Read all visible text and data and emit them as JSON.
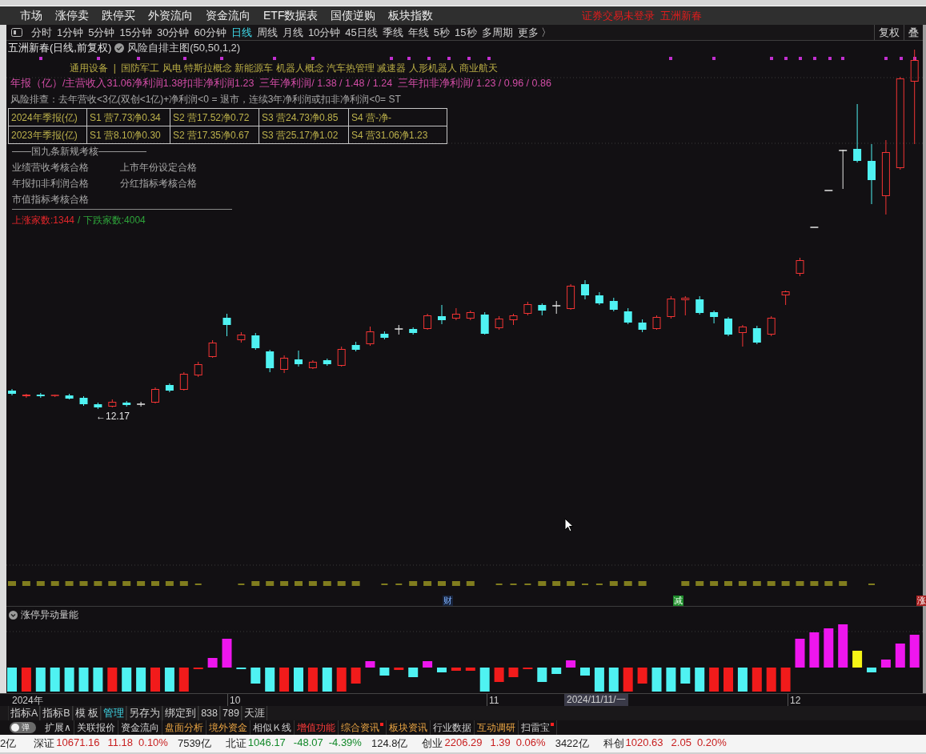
{
  "menu_bar": {
    "items": [
      "市场",
      "涨停卖",
      "跌停买",
      "外资流向",
      "资金流向",
      "ETF数据表",
      "国债逆购",
      "板块指数"
    ],
    "login_status": "证券交易未登录  五洲新春"
  },
  "period_bar": {
    "periods": [
      {
        "label": "分时",
        "selected": false
      },
      {
        "label": "1分钟",
        "selected": false
      },
      {
        "label": "5分钟",
        "selected": false
      },
      {
        "label": "15分钟",
        "selected": false
      },
      {
        "label": "30分钟",
        "selected": false
      },
      {
        "label": "60分钟",
        "selected": false
      },
      {
        "label": "日线",
        "selected": true
      },
      {
        "label": "周线",
        "selected": false
      },
      {
        "label": "月线",
        "selected": false
      },
      {
        "label": "10分钟",
        "selected": false
      },
      {
        "label": "45日线",
        "selected": false
      },
      {
        "label": "季线",
        "selected": false
      },
      {
        "label": "年线",
        "selected": false
      },
      {
        "label": "5秒",
        "selected": false
      },
      {
        "label": "15秒",
        "selected": false
      },
      {
        "label": "多周期",
        "selected": false
      },
      {
        "label": "更多 〉",
        "selected": false
      }
    ],
    "right_buttons": [
      "复权",
      "叠"
    ]
  },
  "main_chart": {
    "title": "五洲新春(日线,前复权)",
    "indicator": "风险自排主图(50,50,1,2)",
    "concepts": "通用设备  |  国防军工 风电 特斯拉概念 新能源车 机器人概念 汽车热管理 减速器 人形机器人 商业航天",
    "annual_report": "年报（亿）/主营收入31.06净利润1.38扣非净利润1.23  三年净利润/ 1.38 / 1.48 / 1.24  三年扣非净利润/ 1.23 / 0.96 / 0.86",
    "risk_check": "风险排查：去年营收<3亿(双创<1亿)+净利润<0 = 退市，连续3年净利润或扣非净利润<0= ST",
    "quarterly_table": [
      [
        "2024年季报(亿)",
        "S1 营7.73净0.34",
        "S2 营17.52净0.72",
        "S3 营24.73净0.85",
        "S4 营-净-"
      ],
      [
        "2023年季报(亿)",
        "S1 营8.10净0.30",
        "S2 营17.35净0.67",
        "S3 营25.17净1.02",
        "S4 营31.06净1.23"
      ]
    ],
    "assessment": {
      "heading": "——国九条新规考核—————",
      "items": [
        "业绩营收考核合格",
        "上市年份设定合格",
        "年报扣非利润合格",
        "分红指标考核合格",
        "市值指标考核合格"
      ]
    },
    "breadth": {
      "advancers": "上涨家数:1344",
      "decliners": "/ 下跌家数:4004"
    },
    "low_price_label": "←12.17",
    "event_markers": [
      {
        "label": "财",
        "kind": "finance"
      },
      {
        "label": "减",
        "kind": "reduce"
      },
      {
        "label": "涨",
        "kind": "limit_up"
      }
    ]
  },
  "sub_chart": {
    "title": "涨停异动量能"
  },
  "x_axis": {
    "labels": [
      "2024年",
      "10",
      "11",
      "12"
    ],
    "cursor_date": "2024/11/11/一"
  },
  "indicator_tabs": [
    {
      "label": "指标A",
      "selected": false
    },
    {
      "label": "指标B",
      "selected": false
    },
    {
      "label": "模 板",
      "selected": false
    },
    {
      "label": "管理",
      "selected": true
    },
    {
      "label": "另存为",
      "selected": false
    },
    {
      "label": "绑定到",
      "selected": false
    },
    {
      "label": "838",
      "selected": false
    },
    {
      "label": "789",
      "selected": false
    },
    {
      "label": "天涯",
      "selected": false
    }
  ],
  "function_bar": {
    "toggle": {
      "label": "弹",
      "on": false
    },
    "items": [
      {
        "label": "扩展∧",
        "kind": "plain",
        "flagged": false
      },
      {
        "label": "关联报价",
        "kind": "plain",
        "flagged": false
      },
      {
        "label": "资金流向",
        "kind": "plain",
        "flagged": false
      },
      {
        "label": "盘面分析",
        "kind": "highlight",
        "flagged": false
      },
      {
        "label": "境外资金",
        "kind": "highlight",
        "flagged": false
      },
      {
        "label": "相似Ｋ线",
        "kind": "plain",
        "flagged": false
      },
      {
        "label": "增值功能",
        "kind": "premium",
        "flagged": false
      },
      {
        "label": "综合资讯",
        "kind": "highlight",
        "flagged": true
      },
      {
        "label": "板块资讯",
        "kind": "highlight",
        "flagged": false
      },
      {
        "label": "行业数据",
        "kind": "plain",
        "flagged": false
      },
      {
        "label": "互动调研",
        "kind": "highlight",
        "flagged": false
      },
      {
        "label": "扫雷宝",
        "kind": "plain",
        "flagged": true
      }
    ]
  },
  "status_bar": {
    "lead": "2亿",
    "markets": [
      {
        "name": "深证",
        "index": "10671.16",
        "change": "11.18",
        "percent": "0.10%",
        "turnover": "7539亿",
        "kind": "up"
      },
      {
        "name": "北证",
        "index": "1046.17",
        "change": "-48.07",
        "percent": "-4.39%",
        "turnover": "124.8亿",
        "kind": "down"
      },
      {
        "name": "创业",
        "index": "2206.29",
        "change": "1.39",
        "percent": "0.06%",
        "turnover": "3422亿",
        "kind": "up"
      },
      {
        "name": "科创",
        "index": "1020.63",
        "change": "2.05",
        "percent": "0.20%",
        "kind": "up"
      }
    ]
  }
}
